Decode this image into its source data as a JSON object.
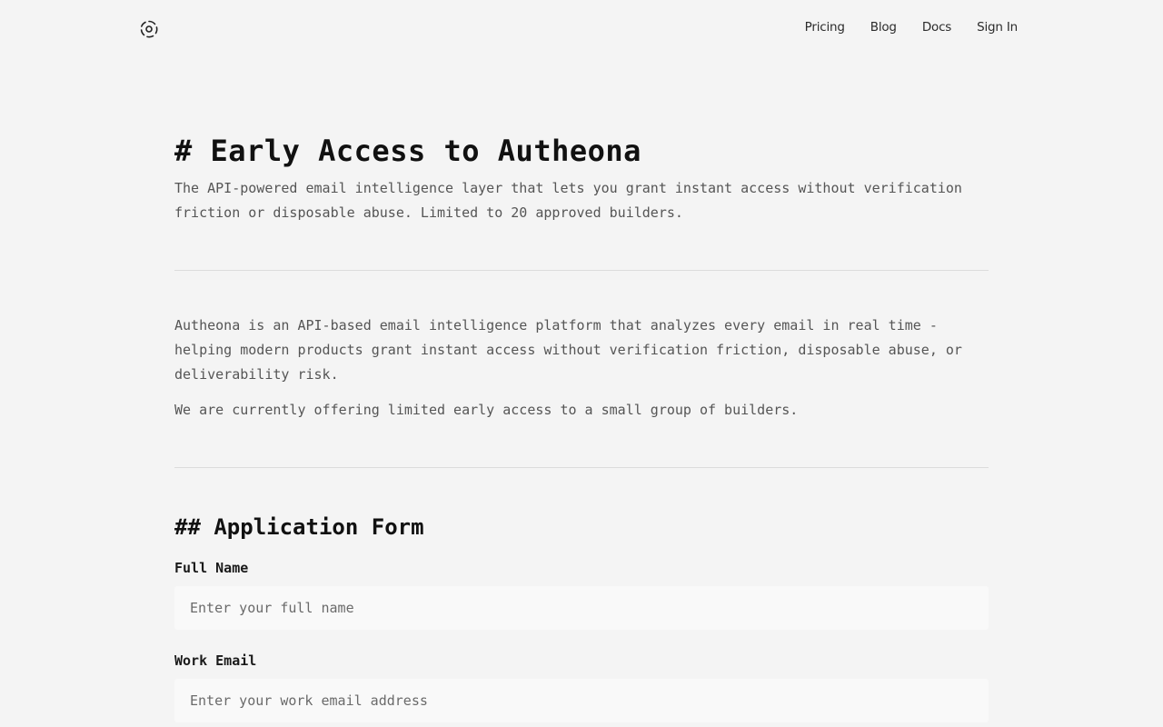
{
  "nav": {
    "logo_icon": "gear-swirl-logo-icon",
    "items": [
      "Pricing",
      "Blog",
      "Docs",
      "Sign In"
    ]
  },
  "hero": {
    "title": "# Early Access to Autheona",
    "lead": "The API-powered email intelligence layer that lets you grant instant access without verification friction or disposable abuse. Limited to 20 approved builders."
  },
  "about": {
    "paragraph_1": "Autheona is an API-based email intelligence platform that analyzes every email in real time - helping modern products grant instant access without verification friction, disposable abuse, or deliverability risk.",
    "paragraph_2": "We are currently offering limited early access to a small group of builders."
  },
  "form": {
    "heading": "## Application Form",
    "full_name": {
      "label": "Full Name",
      "placeholder": "Enter your full name",
      "value": ""
    },
    "work_email": {
      "label": "Work Email",
      "placeholder": "Enter your work email address",
      "value": ""
    }
  }
}
